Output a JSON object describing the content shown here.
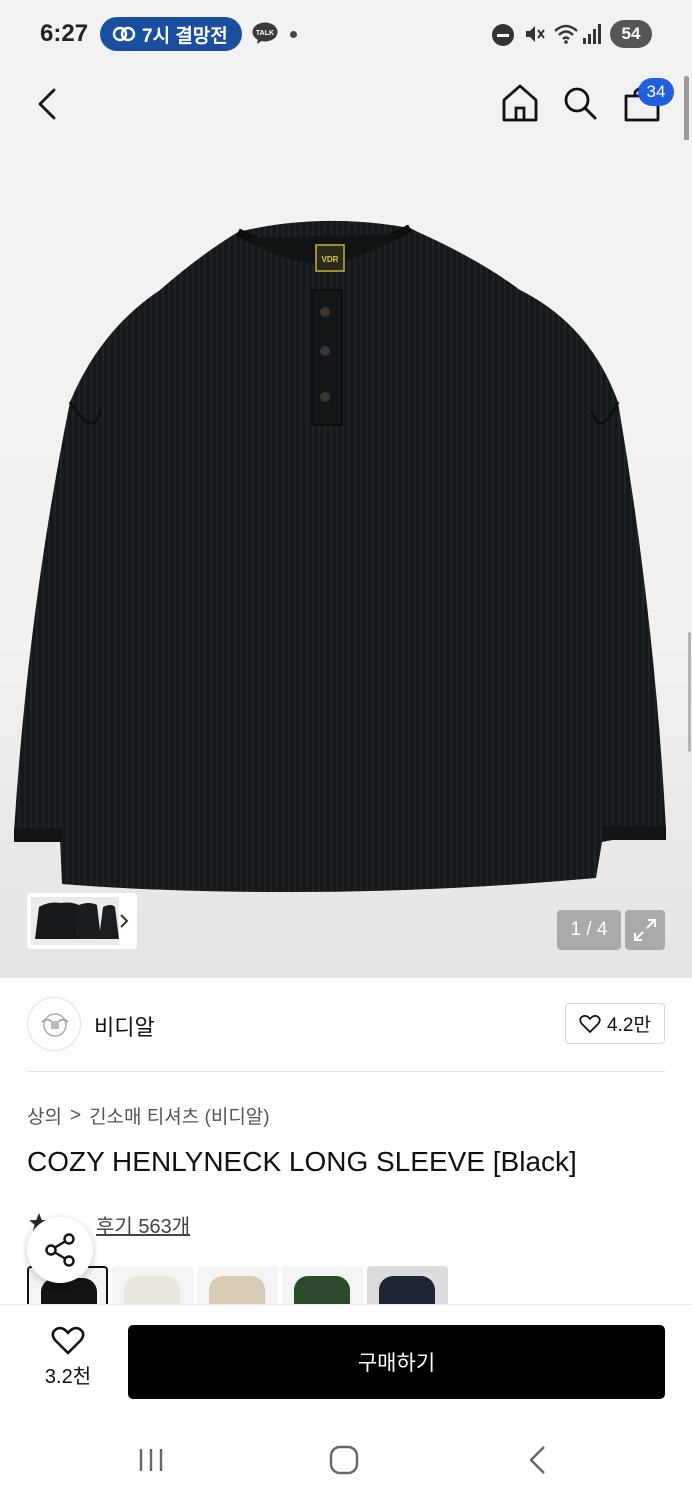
{
  "status_bar": {
    "time": "6:27",
    "alarm_pill": "7시 결망전",
    "talk_badge": "TALK",
    "battery": "54"
  },
  "header": {
    "cart_count": "34"
  },
  "gallery": {
    "page_indicator": "1 / 4",
    "label_text": "VDR"
  },
  "brand": {
    "name": "비디알",
    "like_count": "4.2만"
  },
  "product": {
    "breadcrumb": [
      "상의",
      "긴소매 티셔츠 (비디알)"
    ],
    "breadcrumb_separator": ">",
    "title": "COZY HENLYNECK LONG SLEEVE [Black]",
    "review_text": "후기 563개",
    "color_options": [
      {
        "color": "#121314"
      },
      {
        "color": "#e9e6df"
      },
      {
        "color": "#d9ccb4"
      },
      {
        "color": "#2d4a2c"
      },
      {
        "color": "#202536"
      }
    ]
  },
  "bottom_bar": {
    "wish_count": "3.2천",
    "buy_label": "구매하기"
  },
  "colors": {
    "cart_badge": "#1f5fe0",
    "alarm_pill": "#1a4fa0",
    "buy_button": "#000000"
  }
}
